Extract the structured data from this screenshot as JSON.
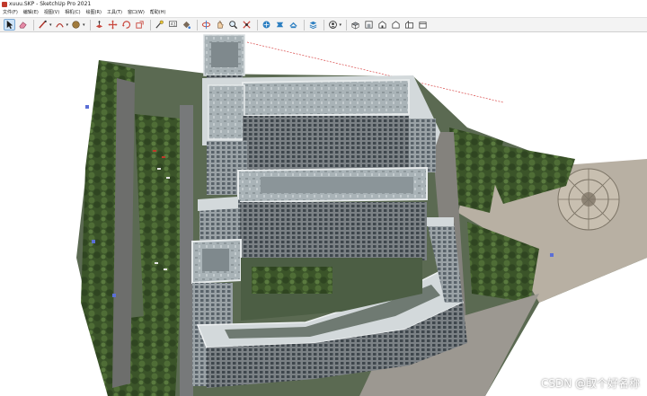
{
  "window": {
    "title": "xuuu.SKP - SketchUp Pro 2021"
  },
  "menu": {
    "items": [
      "文件(F)",
      "编辑(E)",
      "视图(V)",
      "相机(C)",
      "绘图(R)",
      "工具(T)",
      "窗口(W)",
      "帮助(H)"
    ]
  },
  "toolbar": {
    "tools": [
      "select-icon",
      "eraser-icon",
      "line-icon",
      "arc-icon",
      "shape-icon",
      "push-pull-icon",
      "move-icon",
      "rotate-icon",
      "scale-icon",
      "tape-measure-icon",
      "text-icon",
      "paint-icon",
      "orbit-icon",
      "pan-icon",
      "zoom-icon",
      "zoom-extents-icon",
      "warehouse-icon",
      "extension-icon",
      "share-icon",
      "layers-icon",
      "user-icon",
      "top-view-icon",
      "front-view-icon",
      "right-view-icon",
      "back-view-icon",
      "left-view-icon",
      "iso-view-icon"
    ]
  },
  "watermark": {
    "text": "CSDN @取个好名称"
  },
  "colors": {
    "toolbar_bg": "#f3f3f3",
    "active_tool": "#cde3f7",
    "axis_red": "#d94a4a",
    "building_roof": "#b9c3c6",
    "building_facade": "#6d7478",
    "vegetation": "#3f5a2e",
    "plaza": "#b8b0a3"
  }
}
